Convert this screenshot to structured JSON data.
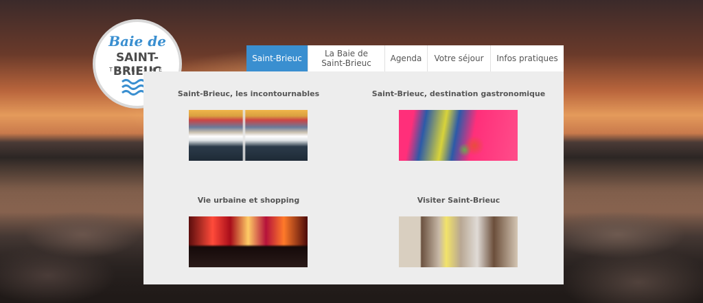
{
  "logo": {
    "line1": "Baie de",
    "line2": "SAINT-BRIEUC",
    "line3": "TOURISME"
  },
  "nav": {
    "items": [
      {
        "label": "Saint-Brieuc",
        "active": true
      },
      {
        "label": "La Baie de Saint-Brieuc",
        "active": false
      },
      {
        "label": "Agenda",
        "active": false
      },
      {
        "label": "Votre séjour",
        "active": false
      },
      {
        "label": "Infos pratiques",
        "active": false
      }
    ]
  },
  "mega_menu": {
    "cards": [
      {
        "title": "Saint-Brieuc, les incontournables",
        "image": "harbor-boats-photo"
      },
      {
        "title": "Saint-Brieuc, destination gastronomique",
        "image": "food-plate-photo"
      },
      {
        "title": "Vie urbaine et shopping",
        "image": "concert-crowd-photo"
      },
      {
        "title": "Visiter Saint-Brieuc",
        "image": "old-town-street-photo"
      }
    ]
  },
  "colors": {
    "accent": "#3a8fd0",
    "menu_bg": "#ededed",
    "nav_bg": "#ffffff"
  }
}
